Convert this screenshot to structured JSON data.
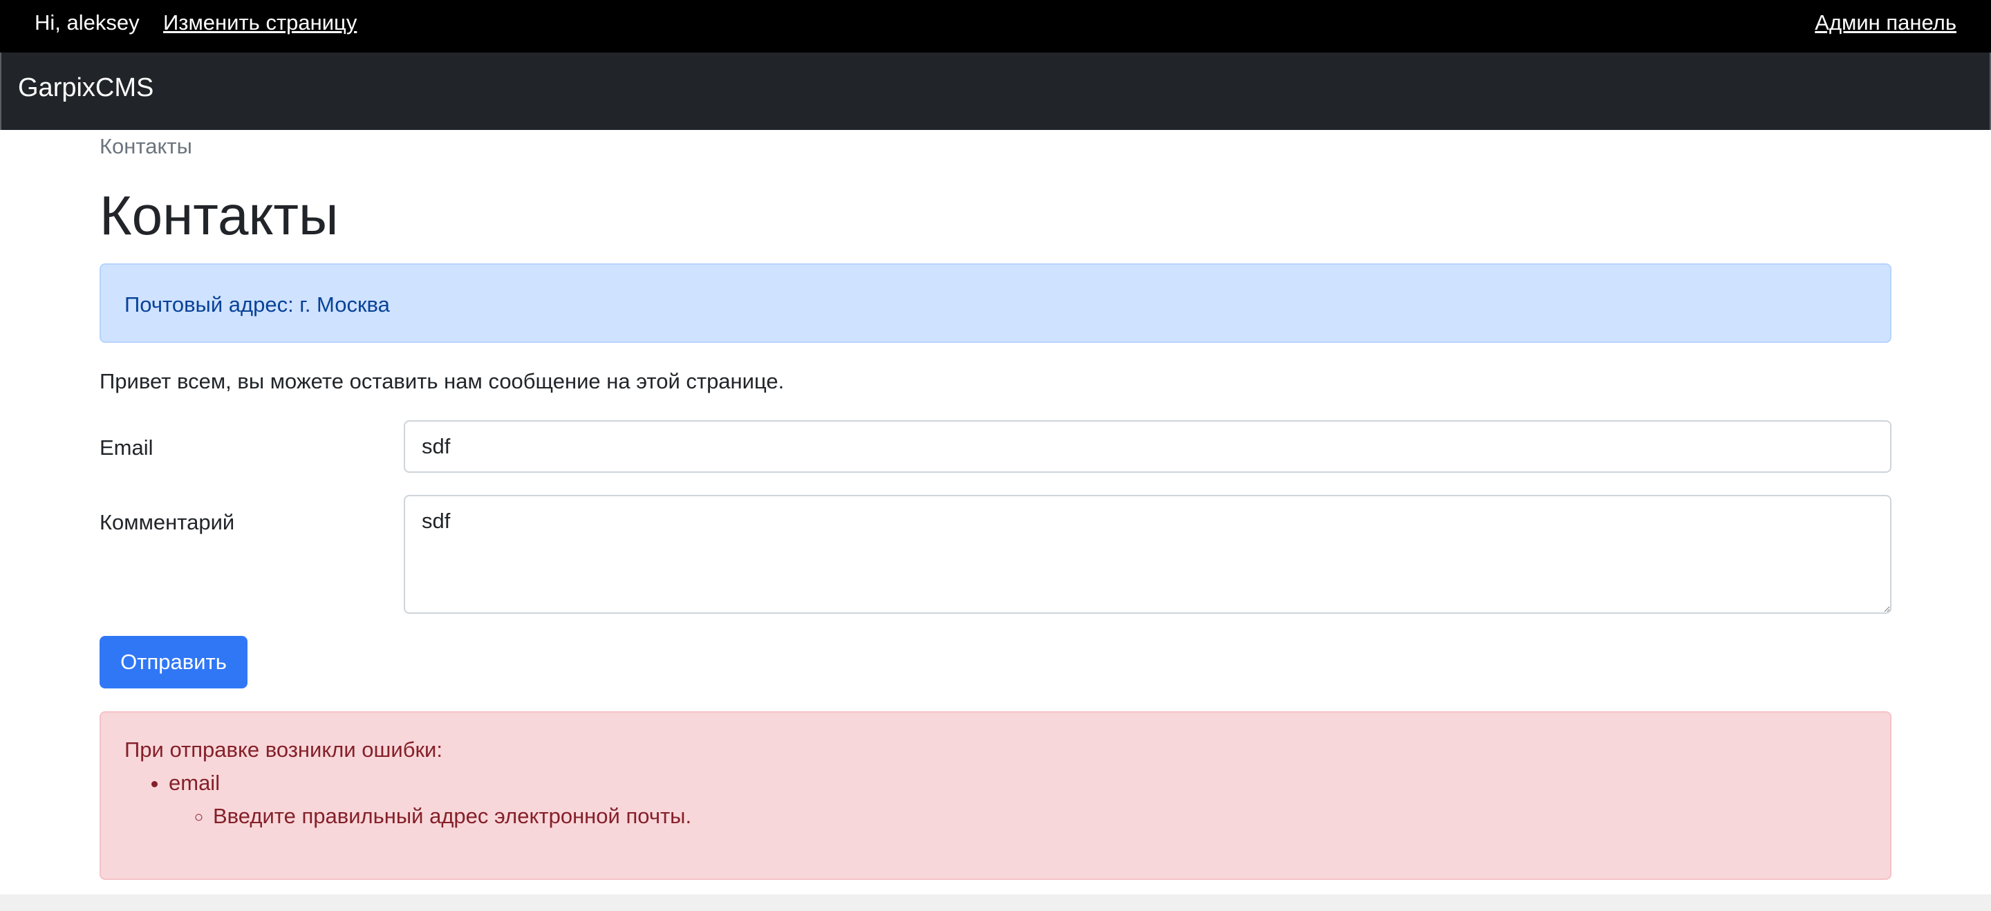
{
  "topbar": {
    "greeting": "Hi, aleksey",
    "edit_page_link": "Изменить страницу",
    "admin_panel_link": "Админ панель"
  },
  "navbar": {
    "brand": "GarpixCMS"
  },
  "breadcrumb": {
    "current": "Контакты"
  },
  "page": {
    "title": "Контакты",
    "info_alert": "Почтовый адрес: г. Москва",
    "intro": "Привет всем, вы можете оставить нам сообщение на этой странице."
  },
  "form": {
    "email_label": "Email",
    "email_value": "sdf",
    "comment_label": "Комментарий",
    "comment_value": "sdf",
    "submit_label": "Отправить"
  },
  "errors": {
    "heading": "При отправке возникли ошибки:",
    "fields": [
      {
        "field": "email",
        "messages": [
          "Введите правильный адрес электронной почты."
        ]
      }
    ]
  },
  "colors": {
    "topbar_bg": "#000000",
    "navbar_bg": "#212529",
    "info_bg": "#cfe2ff",
    "info_text": "#084298",
    "danger_bg": "#f8d7da",
    "danger_text": "#842029",
    "primary": "#3077f6"
  }
}
